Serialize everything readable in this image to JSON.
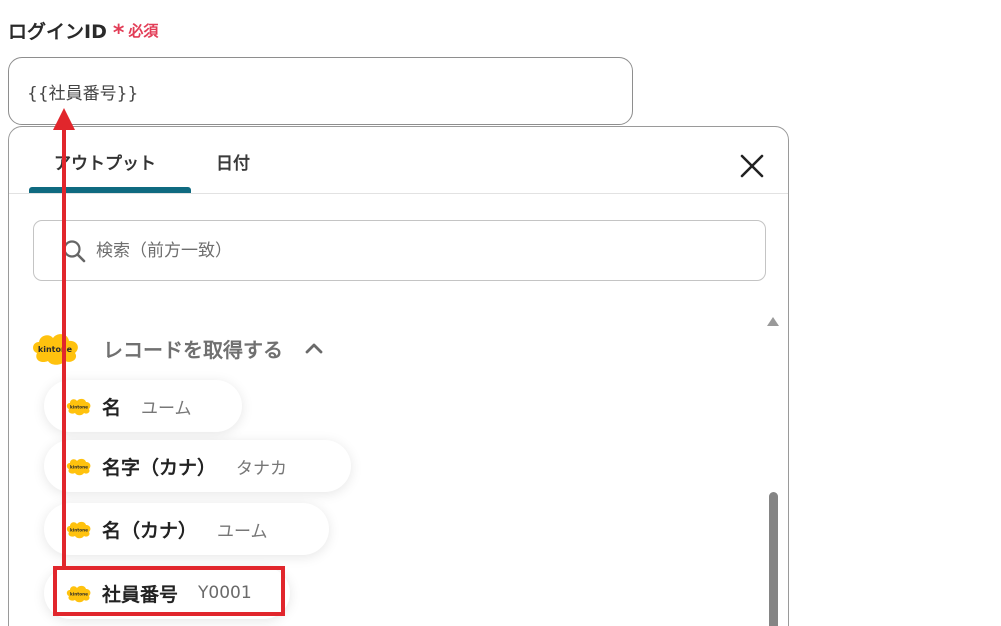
{
  "field": {
    "label": "ログインID",
    "required_mark": "*",
    "required_text": "必須",
    "value": "{{社員番号}}"
  },
  "panel": {
    "tabs": [
      {
        "label": "アウトプット",
        "active": true
      },
      {
        "label": "日付",
        "active": false
      }
    ],
    "search": {
      "placeholder": "検索（前方一致）"
    },
    "section": {
      "title": "レコードを取得する",
      "icon": "kintone-logo"
    },
    "items": [
      {
        "name": "名",
        "value": "ユーム"
      },
      {
        "name": "名字（カナ）",
        "value": "タナカ"
      },
      {
        "name": "名（カナ）",
        "value": "ユーム"
      },
      {
        "name": "社員番号",
        "value": "Y0001"
      }
    ],
    "logo_text": "kintone"
  },
  "colors": {
    "accent": "#0f6a80",
    "required": "#e23d57",
    "annotation": "#e1262c",
    "kintone_yellow": "#ffc20e"
  }
}
